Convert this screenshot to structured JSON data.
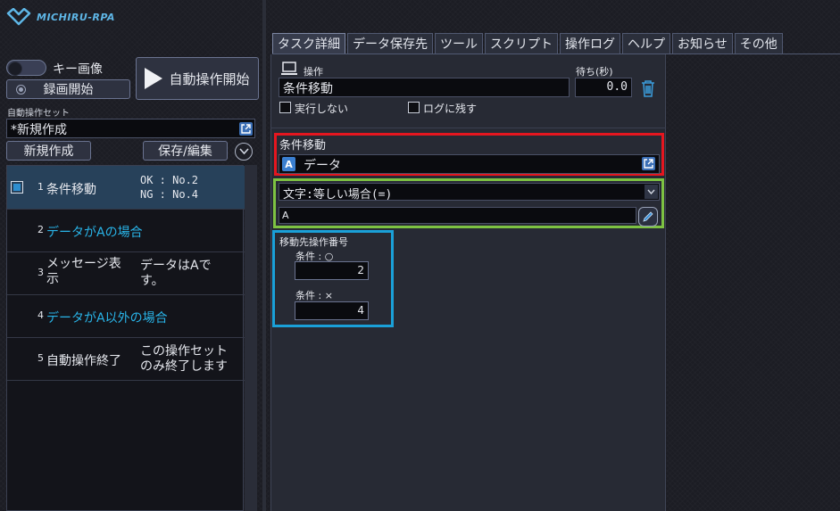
{
  "app": {
    "logo_text": "MICHIRU-RPA"
  },
  "left": {
    "key_image_label": "キー画像",
    "record_label": "録画開始",
    "start_label": "自動操作開始",
    "set_label": "自動操作セット",
    "set_value": "*新規作成",
    "new_label": "新規作成",
    "save_label": "保存/編集",
    "rows": [
      {
        "num": "1",
        "name": "条件移動",
        "note": "OK : No.2\nNG : No.4"
      },
      {
        "num": "2",
        "name": "データがAの場合",
        "note": ""
      },
      {
        "num": "3",
        "name": "メッセージ表\n示",
        "note": "データはAで\nす。"
      },
      {
        "num": "4",
        "name": "データがA以外の場合",
        "note": ""
      },
      {
        "num": "5",
        "name": "自動操作終了",
        "note": "この操作セット\nのみ終了します"
      }
    ]
  },
  "tabs": [
    "タスク詳細",
    "データ保存先",
    "ツール",
    "スクリプト",
    "操作ログ",
    "ヘルプ",
    "お知らせ",
    "その他"
  ],
  "detail": {
    "op_label": "操作",
    "op_value": "条件移動",
    "wait_label": "待ち(秒)",
    "wait_value": "0.0",
    "skip_label": "実行しない",
    "log_label": "ログに残す",
    "cond_label": "条件移動",
    "cond_badge": "A",
    "cond_value": "データ",
    "compare_value": "文字:等しい場合(=)",
    "compare_text": "A",
    "dest_label": "移動先操作番号",
    "true_label": "条件 : ○",
    "true_value": "2",
    "false_label": "条件 : ×",
    "false_value": "4"
  },
  "colors": {
    "red_box": "#e5161f",
    "green_box": "#7dc242",
    "blue_box": "#1aa0d8",
    "link_blue": "#29b4e8"
  }
}
